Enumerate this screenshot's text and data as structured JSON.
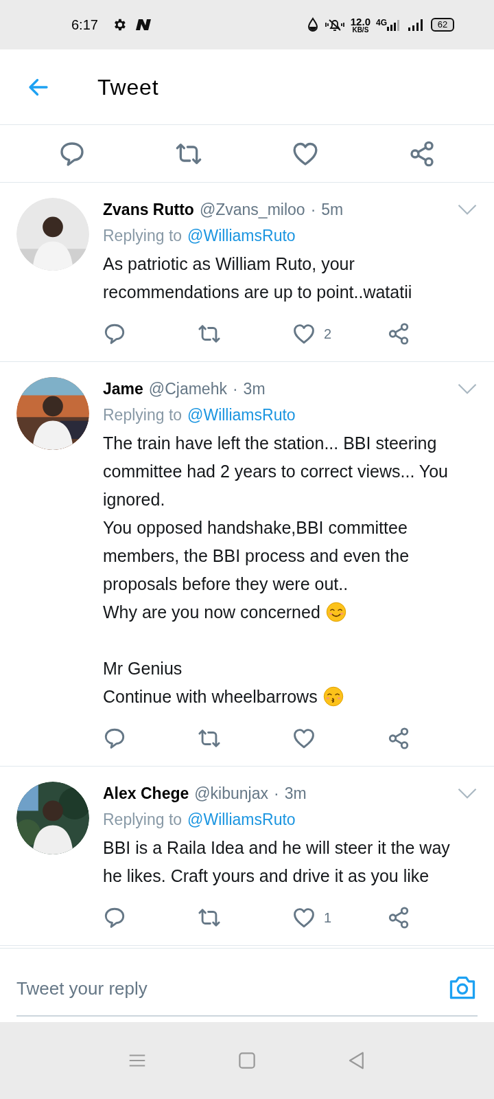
{
  "status_bar": {
    "time": "6:17",
    "speed_value": "12.0",
    "speed_unit": "KB/S",
    "network": "4G",
    "battery": "62"
  },
  "header": {
    "title": "Tweet"
  },
  "replies": [
    {
      "name": "Zvans Rutto",
      "handle": "@Zvans_miloo",
      "separator": "·",
      "time": "5m",
      "replying_label": "Replying to",
      "replying_to": "@WilliamsRuto",
      "lines": [
        {
          "text": "As patriotic as William Ruto, your recommendations are up to point..watatii"
        }
      ],
      "likes": "2"
    },
    {
      "name": "Jame",
      "handle": "@Cjamehk",
      "separator": "·",
      "time": "3m",
      "replying_label": "Replying to",
      "replying_to": "@WilliamsRuto",
      "lines": [
        {
          "text": "The train have left the station... BBI steering committee had 2 years to correct views... You ignored."
        },
        {
          "text": "You opposed handshake,BBI committee members, the BBI process and even the proposals before they were out.."
        },
        {
          "text": "Why are you now concerned",
          "kind": "smile"
        },
        {
          "kind": "blank"
        },
        {
          "text": "Mr Genius"
        },
        {
          "text": "Continue with wheelbarrows",
          "kind": "kiss"
        }
      ]
    },
    {
      "name": "Alex Chege",
      "handle": "@kibunjax",
      "separator": "·",
      "time": "3m",
      "replying_label": "Replying to",
      "replying_to": "@WilliamsRuto",
      "lines": [
        {
          "text": "BBI is a Raila Idea and he will steer it the way he likes. Craft yours and drive it as you like"
        }
      ],
      "likes": "1"
    }
  ],
  "composer": {
    "placeholder": "Tweet your reply"
  }
}
